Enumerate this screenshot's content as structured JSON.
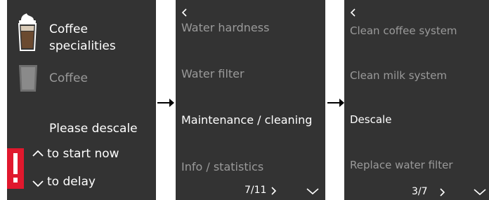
{
  "colors": {
    "screen_bg": "#333333",
    "text_active": "#ffffff",
    "text_inactive": "#9a9a9a",
    "alert": "#e0182d"
  },
  "screen1": {
    "item1_label_line1": "Coffee",
    "item1_label_line2": "specialities",
    "item1_icon": "coffee-specialities-cup-icon",
    "item2_label": "Coffee",
    "item2_icon": "coffee-glass-icon",
    "message": "Please descale",
    "action_up": "to start now",
    "action_down": "to delay",
    "alert_icon": "exclamation-icon"
  },
  "screen2": {
    "back_icon": "chevron-left-icon",
    "items": [
      "Water hardness",
      "Water filter",
      "Maintenance / cleaning",
      "Info / statistics"
    ],
    "selected_index": 2,
    "page_indicator": "7/11",
    "next_icon": "chevron-right-icon",
    "down_icon": "chevron-down-icon"
  },
  "screen3": {
    "back_icon": "chevron-left-icon",
    "items": [
      "Clean coffee system",
      "Clean milk system",
      "Descale",
      "Replace water filter"
    ],
    "selected_index": 2,
    "page_indicator": "3/7",
    "next_icon": "chevron-right-icon",
    "down_icon": "chevron-down-icon"
  },
  "flow_arrow_icon": "arrow-right-icon"
}
